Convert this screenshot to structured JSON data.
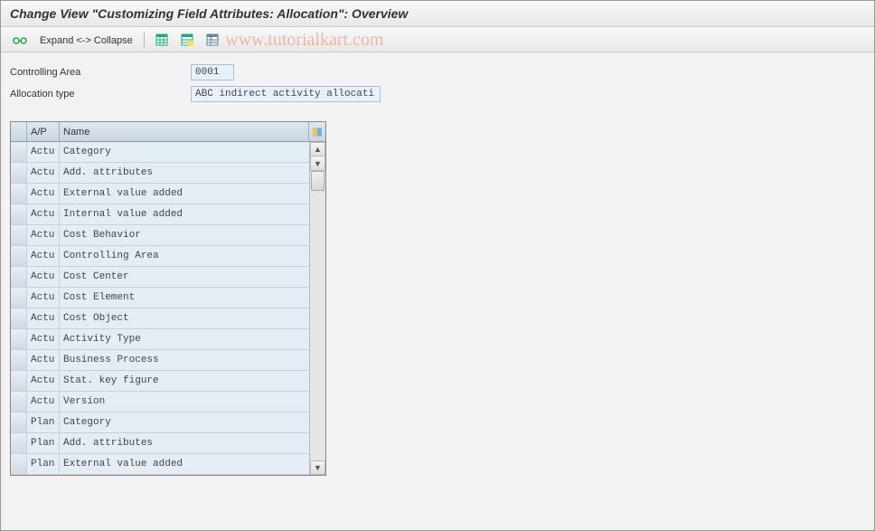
{
  "title": "Change View \"Customizing Field Attributes: Allocation\": Overview",
  "toolbar": {
    "expand_collapse": "Expand <-> Collapse"
  },
  "watermark": "www.tutorialkart.com",
  "fields": {
    "controlling_area_label": "Controlling Area",
    "controlling_area_value": "0001",
    "allocation_type_label": "Allocation type",
    "allocation_type_value": "ABC indirect activity allocati"
  },
  "table": {
    "columns": {
      "ap": "A/P",
      "name": "Name"
    },
    "rows": [
      {
        "ap": "Actu",
        "name": "Category"
      },
      {
        "ap": "Actu",
        "name": "Add. attributes"
      },
      {
        "ap": "Actu",
        "name": "External value added"
      },
      {
        "ap": "Actu",
        "name": "Internal value added"
      },
      {
        "ap": "Actu",
        "name": "Cost Behavior"
      },
      {
        "ap": "Actu",
        "name": "Controlling Area"
      },
      {
        "ap": "Actu",
        "name": "Cost Center"
      },
      {
        "ap": "Actu",
        "name": "Cost Element"
      },
      {
        "ap": "Actu",
        "name": "Cost Object"
      },
      {
        "ap": "Actu",
        "name": "Activity Type"
      },
      {
        "ap": "Actu",
        "name": "Business Process"
      },
      {
        "ap": "Actu",
        "name": "Stat. key figure"
      },
      {
        "ap": "Actu",
        "name": "Version"
      },
      {
        "ap": "Plan",
        "name": "Category"
      },
      {
        "ap": "Plan",
        "name": "Add. attributes"
      },
      {
        "ap": "Plan",
        "name": "External value added"
      }
    ]
  }
}
